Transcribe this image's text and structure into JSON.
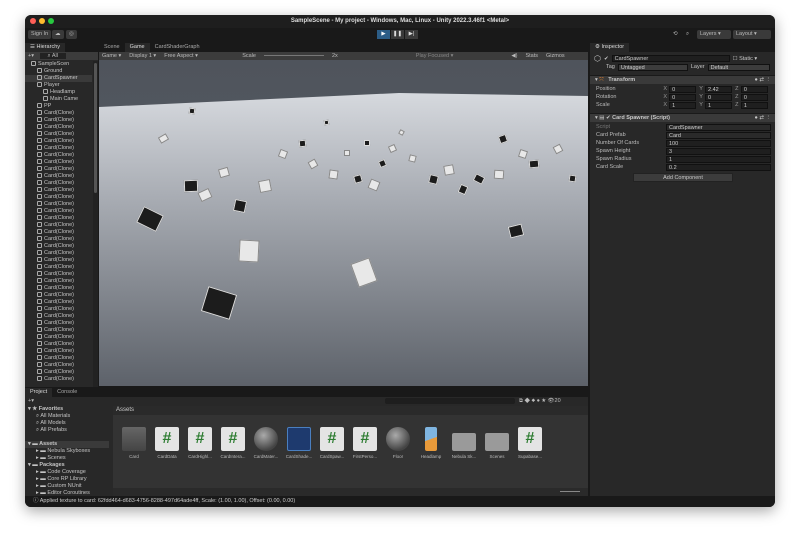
{
  "window": {
    "title": "SampleScene - My project - Windows, Mac, Linux - Unity 2022.3.46f1 <Metal>"
  },
  "toolbar": {
    "sign_in": "Sign In",
    "layers": "Layers",
    "layout": "Layout"
  },
  "hierarchy": {
    "tab": "Hierarchy",
    "search_placeholder": "All",
    "items": [
      {
        "label": "SampleScen",
        "indent": 1
      },
      {
        "label": "Ground",
        "indent": 2
      },
      {
        "label": "CardSpawner",
        "indent": 2,
        "selected": true
      },
      {
        "label": "Player",
        "indent": 2
      },
      {
        "label": "Headlamp",
        "indent": 3
      },
      {
        "label": "Main Came",
        "indent": 3
      },
      {
        "label": "PP",
        "indent": 2
      },
      {
        "label": "Card(Clone)",
        "indent": 2
      },
      {
        "label": "Card(Clone)",
        "indent": 2
      },
      {
        "label": "Card(Clone)",
        "indent": 2
      },
      {
        "label": "Card(Clone)",
        "indent": 2
      },
      {
        "label": "Card(Clone)",
        "indent": 2
      },
      {
        "label": "Card(Clone)",
        "indent": 2
      },
      {
        "label": "Card(Clone)",
        "indent": 2
      },
      {
        "label": "Card(Clone)",
        "indent": 2
      },
      {
        "label": "Card(Clone)",
        "indent": 2
      },
      {
        "label": "Card(Clone)",
        "indent": 2
      },
      {
        "label": "Card(Clone)",
        "indent": 2
      },
      {
        "label": "Card(Clone)",
        "indent": 2
      },
      {
        "label": "Card(Clone)",
        "indent": 2
      },
      {
        "label": "Card(Clone)",
        "indent": 2
      },
      {
        "label": "Card(Clone)",
        "indent": 2
      },
      {
        "label": "Card(Clone)",
        "indent": 2
      },
      {
        "label": "Card(Clone)",
        "indent": 2
      },
      {
        "label": "Card(Clone)",
        "indent": 2
      },
      {
        "label": "Card(Clone)",
        "indent": 2
      },
      {
        "label": "Card(Clone)",
        "indent": 2
      },
      {
        "label": "Card(Clone)",
        "indent": 2
      },
      {
        "label": "Card(Clone)",
        "indent": 2
      },
      {
        "label": "Card(Clone)",
        "indent": 2
      },
      {
        "label": "Card(Clone)",
        "indent": 2
      },
      {
        "label": "Card(Clone)",
        "indent": 2
      },
      {
        "label": "Card(Clone)",
        "indent": 2
      },
      {
        "label": "Card(Clone)",
        "indent": 2
      },
      {
        "label": "Card(Clone)",
        "indent": 2
      },
      {
        "label": "Card(Clone)",
        "indent": 2
      },
      {
        "label": "Card(Clone)",
        "indent": 2
      },
      {
        "label": "Card(Clone)",
        "indent": 2
      },
      {
        "label": "Card(Clone)",
        "indent": 2
      },
      {
        "label": "Card(Clone)",
        "indent": 2
      },
      {
        "label": "Card(Clone)",
        "indent": 2
      },
      {
        "label": "Card(Clone)",
        "indent": 2
      },
      {
        "label": "Card(Clone)",
        "indent": 2
      },
      {
        "label": "Card(Clone)",
        "indent": 2
      },
      {
        "label": "Card(Clone)",
        "indent": 2
      },
      {
        "label": "Card(Clone)",
        "indent": 2
      }
    ]
  },
  "center": {
    "tabs": [
      "Scene",
      "Game",
      "CardShaderGraph"
    ],
    "game_dropdown": "Game",
    "display": "Display 1",
    "aspect": "Free Aspect",
    "scale_label": "Scale",
    "scale_value": "2x",
    "play_mode": "Play Focused",
    "stats": "Stats",
    "gizmos": "Gizmos"
  },
  "inspector": {
    "tab": "Inspector",
    "object_name": "CardSpawner",
    "static_label": "Static",
    "tag_label": "Tag",
    "tag": "Untagged",
    "layer_label": "Layer",
    "layer": "Default",
    "transform": {
      "title": "Transform",
      "rows": [
        {
          "label": "Position",
          "x": "0",
          "y": "2.42",
          "z": "0"
        },
        {
          "label": "Rotation",
          "x": "0",
          "y": "0",
          "z": "0"
        },
        {
          "label": "Scale",
          "x": "1",
          "y": "1",
          "z": "1"
        }
      ]
    },
    "script": {
      "title": "Card Spawner (Script)",
      "rows": [
        {
          "label": "Script",
          "value": "CardSpawner"
        },
        {
          "label": "Card Prefab",
          "value": "Card"
        },
        {
          "label": "Number Of Cards",
          "value": "100"
        },
        {
          "label": "Spawn Height",
          "value": "3"
        },
        {
          "label": "Spawn Radius",
          "value": "1"
        },
        {
          "label": "Card Scale",
          "value": "0.2"
        }
      ]
    },
    "add_component": "Add Component"
  },
  "project": {
    "tabs": [
      "Project",
      "Console"
    ],
    "tree": [
      {
        "label": "Favorites",
        "indent": 0,
        "bold": true
      },
      {
        "label": "All Materials",
        "indent": 2
      },
      {
        "label": "All Models",
        "indent": 2
      },
      {
        "label": "All Prefabs",
        "indent": 2
      },
      {
        "label": "",
        "indent": 0
      },
      {
        "label": "Assets",
        "indent": 0,
        "bold": true,
        "selected": true
      },
      {
        "label": "Nebula Skyboxes",
        "indent": 2
      },
      {
        "label": "Scenes",
        "indent": 2
      },
      {
        "label": "Packages",
        "indent": 0,
        "bold": true
      },
      {
        "label": "Code Coverage",
        "indent": 2
      },
      {
        "label": "Core RP Library",
        "indent": 2
      },
      {
        "label": "Custom NUnit",
        "indent": 2
      },
      {
        "label": "Editor Coroutines",
        "indent": 2
      }
    ],
    "breadcrumb": "Assets",
    "hidden_count": "20",
    "assets": [
      {
        "label": "Card",
        "kind": "prefab"
      },
      {
        "label": "CardData",
        "kind": "script"
      },
      {
        "label": "CardHighl...",
        "kind": "script"
      },
      {
        "label": "CardIntera...",
        "kind": "script"
      },
      {
        "label": "CardMater...",
        "kind": "material"
      },
      {
        "label": "CardShade...",
        "kind": "shader"
      },
      {
        "label": "CardSpaw...",
        "kind": "script"
      },
      {
        "label": "FirstPerso...",
        "kind": "script"
      },
      {
        "label": "Floor",
        "kind": "material"
      },
      {
        "label": "Headlamp",
        "kind": "logo"
      },
      {
        "label": "Nebula Sk...",
        "kind": "folder"
      },
      {
        "label": "Scenes",
        "kind": "folder"
      },
      {
        "label": "Supabase...",
        "kind": "script"
      }
    ]
  },
  "status": {
    "message": "Applied texture to card: 62fdd464-d683-4756-8288-497d64ade4ff, Scale: (1.00, 1.00), Offset: (0.00, 0.00)"
  }
}
